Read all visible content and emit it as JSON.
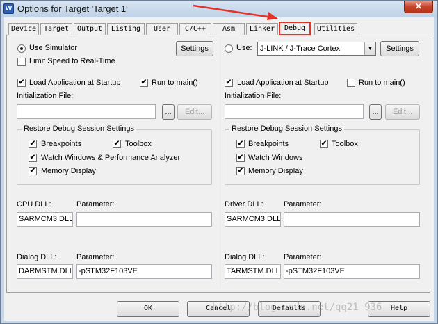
{
  "window": {
    "title": "Options for Target 'Target 1'",
    "close_glyph": "✕",
    "icon_glyph": "W"
  },
  "tabs": [
    {
      "label": "Device"
    },
    {
      "label": "Target"
    },
    {
      "label": "Output"
    },
    {
      "label": "Listing"
    },
    {
      "label": "User"
    },
    {
      "label": "C/C++"
    },
    {
      "label": "Asm"
    },
    {
      "label": "Linker"
    },
    {
      "label": "Debug",
      "active": true
    },
    {
      "label": "Utilities"
    }
  ],
  "left": {
    "use_simulator": {
      "label": "Use Simulator",
      "selected": true
    },
    "settings_label": "Settings",
    "limit_speed": {
      "label": "Limit Speed to Real-Time",
      "checked": false
    },
    "load_app": {
      "label": "Load Application at Startup",
      "checked": true
    },
    "run_to_main": {
      "label": "Run to main()",
      "checked": true
    },
    "init_file_label": "Initialization File:",
    "init_file_value": "",
    "browse_label": "...",
    "edit_label": "Edit...",
    "restore_title": "Restore Debug Session Settings",
    "breakpoints": {
      "label": "Breakpoints",
      "checked": true
    },
    "toolbox": {
      "label": "Toolbox",
      "checked": true
    },
    "watch": {
      "label": "Watch Windows & Performance Analyzer",
      "checked": true
    },
    "memory": {
      "label": "Memory Display",
      "checked": true
    },
    "cpu_dll_label": "CPU DLL:",
    "cpu_dll_value": "SARMCM3.DLL",
    "cpu_param_label": "Parameter:",
    "cpu_param_value": "",
    "dialog_dll_label": "Dialog DLL:",
    "dialog_dll_value": "DARMSTM.DLL",
    "dialog_param_label": "Parameter:",
    "dialog_param_value": "-pSTM32F103VE"
  },
  "right": {
    "use": {
      "label": "Use:",
      "selected": false
    },
    "driver_select": "J-LINK / J-Trace Cortex",
    "settings_label": "Settings",
    "load_app": {
      "label": "Load Application at Startup",
      "checked": true
    },
    "run_to_main": {
      "label": "Run to main()",
      "checked": false
    },
    "init_file_label": "Initialization File:",
    "init_file_value": "",
    "browse_label": "...",
    "edit_label": "Edit...",
    "restore_title": "Restore Debug Session Settings",
    "breakpoints": {
      "label": "Breakpoints",
      "checked": true
    },
    "toolbox": {
      "label": "Toolbox",
      "checked": true
    },
    "watch": {
      "label": "Watch Windows",
      "checked": true
    },
    "memory": {
      "label": "Memory Display",
      "checked": true
    },
    "driver_dll_label": "Driver DLL:",
    "driver_dll_value": "SARMCM3.DLL",
    "driver_param_label": "Parameter:",
    "driver_param_value": "",
    "dialog_dll_label": "Dialog DLL:",
    "dialog_dll_value": "TARMSTM.DLL",
    "dialog_param_label": "Parameter:",
    "dialog_param_value": "-pSTM32F103VE"
  },
  "footer": {
    "ok": "OK",
    "cancel": "Cancel",
    "defaults": "Defaults",
    "help": "Help"
  },
  "watermark": "http://blog.csdn.net/qq21 936",
  "colors": {
    "highlight": "#e53127",
    "titlebar": "#c7d7ea",
    "dialog_bg": "#f0f0f0"
  },
  "check_glyph": "✔"
}
